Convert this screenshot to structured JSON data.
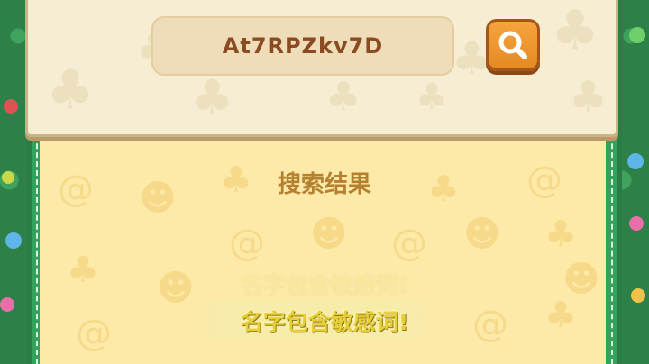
{
  "search": {
    "value": "At7RPZkv7D",
    "button_icon": "search-icon"
  },
  "results": {
    "title": "搜索结果"
  },
  "toast": {
    "message_faded": "名字包含敏感词!",
    "message": "名字包含敏感词!"
  },
  "colors": {
    "background_green": "#2f8a4e",
    "panel_green": "#34a15d",
    "parchment": "#f6edd2",
    "input_fill": "#efdcb8",
    "input_text": "#8a4b22",
    "button_orange": "#f09a34",
    "results_yellow": "#fde9a8",
    "title_brown": "#b5802f",
    "toast_yellow": "#e8cf3a"
  }
}
